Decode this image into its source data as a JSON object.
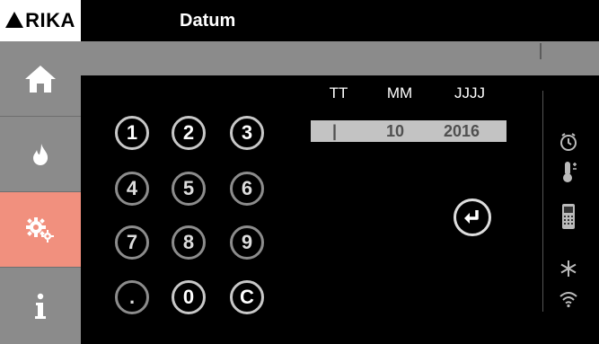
{
  "header": {
    "logo_text": "RIKA",
    "title": "Datum"
  },
  "sidebar": {
    "items": [
      {
        "icon": "home-icon",
        "active": false
      },
      {
        "icon": "flame-icon",
        "active": false
      },
      {
        "icon": "gears-icon",
        "active": true
      },
      {
        "icon": "info-icon",
        "active": false
      }
    ],
    "active_color": "#f1907e",
    "inactive_color": "#8b8b8b"
  },
  "keypad": {
    "keys": [
      "1",
      "2",
      "3",
      "4",
      "5",
      "6",
      "7",
      "8",
      "9",
      ".",
      "0",
      "C"
    ]
  },
  "date_entry": {
    "headers": {
      "day": "TT",
      "month": "MM",
      "year": "JJJJ"
    },
    "values": {
      "day": "|",
      "month": "10",
      "year": "2016"
    }
  },
  "status_icons": [
    "clock-icon",
    "thermometer-icon",
    "remote-icon",
    "snowflake-icon",
    "wifi-icon"
  ]
}
